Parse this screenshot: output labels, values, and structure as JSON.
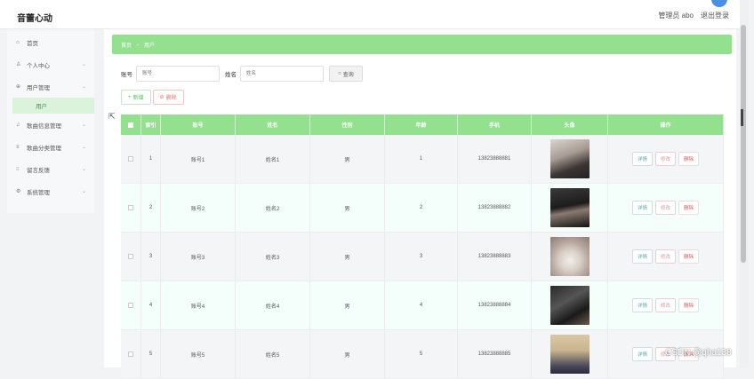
{
  "app": {
    "title": "音蕾心动"
  },
  "user": {
    "role_label": "管理员 abo",
    "logout_label": "退出登录"
  },
  "sidebar": {
    "items": [
      {
        "icon": "home-icon",
        "glyph": "⌂",
        "label": "首页",
        "chev": ""
      },
      {
        "icon": "user-icon",
        "glyph": "♙",
        "label": "个人中心",
        "chev": "⌄"
      },
      {
        "icon": "users-icon",
        "glyph": "⊕",
        "label": "用户管理",
        "chev": "⌄"
      },
      {
        "icon": "",
        "glyph": "",
        "label": "用户",
        "chev": "",
        "sub": true
      },
      {
        "icon": "music-icon",
        "glyph": "♫",
        "label": "歌曲信息管理",
        "chev": "⌄"
      },
      {
        "icon": "category-icon",
        "glyph": "≡",
        "label": "歌曲分类管理",
        "chev": "⌄"
      },
      {
        "icon": "grid-icon",
        "glyph": "⁝⁝",
        "label": "留言反馈",
        "chev": "⌄"
      },
      {
        "icon": "settings-icon",
        "glyph": "⚙",
        "label": "系统管理",
        "chev": "⌄"
      }
    ]
  },
  "breadcrumb": {
    "home": "首页",
    "sep": "→",
    "current": "用户"
  },
  "search": {
    "account_label": "账号",
    "account_placeholder": "账号",
    "name_label": "姓名",
    "name_placeholder": "姓名",
    "button": "查询"
  },
  "actions": {
    "add": "新增",
    "delete": "删除"
  },
  "table": {
    "headers": [
      "",
      "索引",
      "账号",
      "姓名",
      "性别",
      "年龄",
      "手机",
      "头像",
      "操作"
    ],
    "rows": [
      {
        "index": "1",
        "account": "账号1",
        "name": "姓名1",
        "gender": "男",
        "age": "1",
        "phone": "13823888881",
        "photo": "photo-1"
      },
      {
        "index": "2",
        "account": "账号2",
        "name": "姓名2",
        "gender": "男",
        "age": "2",
        "phone": "13823888882",
        "photo": "photo-2"
      },
      {
        "index": "3",
        "account": "账号3",
        "name": "姓名3",
        "gender": "男",
        "age": "3",
        "phone": "13823888883",
        "photo": "photo-3"
      },
      {
        "index": "4",
        "account": "账号4",
        "name": "姓名4",
        "gender": "男",
        "age": "4",
        "phone": "13823888884",
        "photo": "photo-4"
      },
      {
        "index": "5",
        "account": "账号5",
        "name": "姓名5",
        "gender": "男",
        "age": "5",
        "phone": "13823888885",
        "photo": "photo-5"
      }
    ],
    "ops": {
      "detail": "详情",
      "edit": "修改",
      "delete": "删除"
    }
  },
  "watermark": "CSDN @qha138",
  "colors": {
    "accent": "#93e18f",
    "sidebar_active_bg": "#dbf3db"
  }
}
